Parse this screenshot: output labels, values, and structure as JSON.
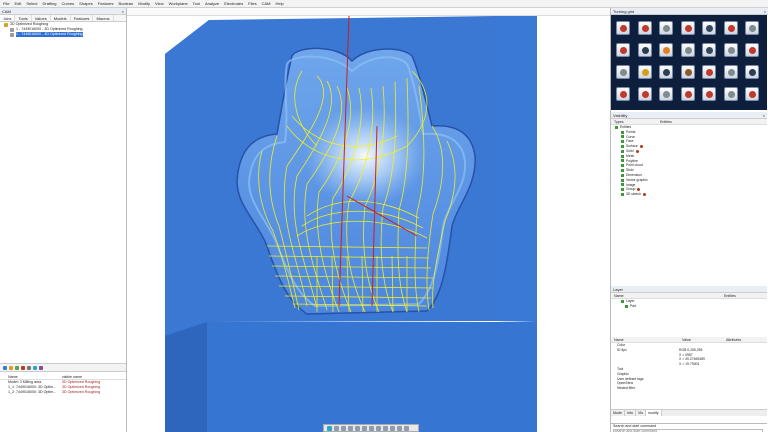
{
  "menu": [
    "File",
    "Edit",
    "Select",
    "Drafting",
    "Curves",
    "Shapes",
    "Features",
    "Boolean",
    "Modify",
    "View",
    "Workplane",
    "Tool",
    "Analyze",
    "Electrodes",
    "Files",
    "CAM",
    "Help"
  ],
  "left_panel": {
    "title": "CAM",
    "tabs": [
      "Jobs",
      "Tools",
      "Values",
      "Models",
      "Features",
      "Macros"
    ],
    "tree": [
      "3D Optimized Roughing",
      "1 - 7449016000 - 3D Optimized Roughing",
      "1 - 7449016000 - 3D Optimized Roughing"
    ],
    "op_table": {
      "headers": [
        "Name",
        "visible name"
      ],
      "rows": [
        {
          "name": "Model: 3 Milling area",
          "value": "3D Optimized Roughing"
        },
        {
          "name": "1_1: 7449016000: 3D Optim...",
          "value": "3D Optimized Roughing"
        },
        {
          "name": "1_2: 7449016000: 3D Optim...",
          "value": "3D Optimized Roughing"
        }
      ]
    }
  },
  "right_panel": {
    "turning_title": "Turning grid",
    "visibility": {
      "title": "Visibility",
      "headers": [
        "Types",
        "Entities"
      ],
      "items": [
        {
          "label": "Entities",
          "dot": false
        },
        {
          "label": "Points",
          "dot": false
        },
        {
          "label": "Curve",
          "dot": false
        },
        {
          "label": "Face",
          "dot": false
        },
        {
          "label": "Surface",
          "dot": true
        },
        {
          "label": "Solid",
          "dot": true
        },
        {
          "label": "Mesh",
          "dot": false
        },
        {
          "label": "Polyline",
          "dot": false
        },
        {
          "label": "Point cloud",
          "dot": false
        },
        {
          "label": "Sbdv",
          "dot": false
        },
        {
          "label": "Dimension",
          "dot": false
        },
        {
          "label": "Vector graphic",
          "dot": false
        },
        {
          "label": "Image",
          "dot": false
        },
        {
          "label": "Group",
          "dot": true
        },
        {
          "label": "3D sketch",
          "dot": true
        }
      ]
    },
    "layer": {
      "title": "Layer",
      "headers": [
        "Name",
        "Entities"
      ],
      "items": [
        "Layer",
        "Part"
      ]
    },
    "properties": {
      "headers": [
        "Name",
        "Value",
        "Attributes"
      ],
      "rows": [
        {
          "k": "Color",
          "v": ""
        },
        {
          "k": "ID 6px",
          "v": "RGB 0,255,255"
        },
        {
          "k": "",
          "v": "X = 0987"
        },
        {
          "k": "",
          "v": "X = 39.27469389"
        },
        {
          "k": "",
          "v": "X = 19.79304"
        },
        {
          "k": "Tool",
          "v": ""
        },
        {
          "k": "Graphic",
          "v": ""
        },
        {
          "k": "User defined tags",
          "v": ""
        },
        {
          "k": "Open/New",
          "v": ""
        },
        {
          "k": "Nested filter",
          "v": ""
        }
      ]
    },
    "bottom_tabs": [
      "Mode",
      "Info",
      "Vis",
      "modify"
    ],
    "command_caption": "Search and start command",
    "command_placeholder": "Search and start command"
  },
  "colors": {
    "part_blue": "#3a78d4",
    "toolpath_yellow": "#f3f31a",
    "selection_blue": "#2f6fd1",
    "turning_bg": "#0d1f3d"
  }
}
